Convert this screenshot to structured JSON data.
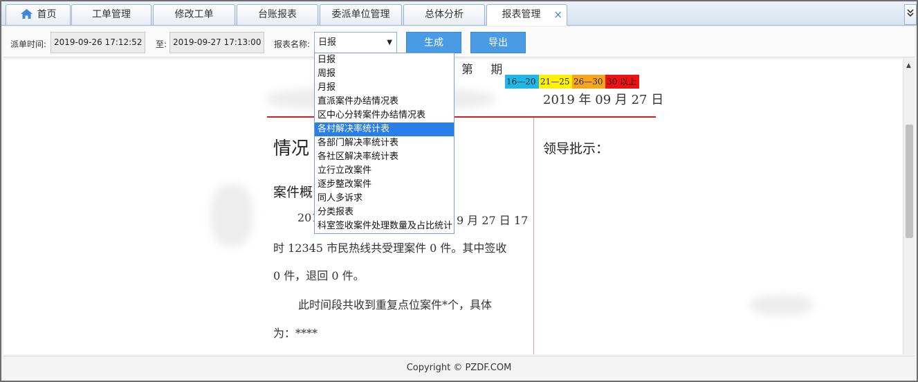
{
  "tabs": [
    {
      "label": "首页",
      "icon": "home-icon"
    },
    {
      "label": "工单管理"
    },
    {
      "label": "修改工单"
    },
    {
      "label": "台账报表"
    },
    {
      "label": "委派单位管理"
    },
    {
      "label": "总体分析"
    },
    {
      "label": "报表管理",
      "active": true,
      "close": "×"
    }
  ],
  "tab_scroll_glyph": "¥",
  "toolbar": {
    "dispatch_time_label": "派单时间:",
    "start_time": "2019-09-26 17:12:52",
    "to_label": "至:",
    "end_time": "2019-09-27 17:13:00",
    "report_name_label": "报表名称:",
    "report_selected": "日报",
    "generate_label": "生成",
    "export_label": "导出"
  },
  "dropdown": {
    "options": [
      "日报",
      "周报",
      "月报",
      "直派案件办结情况表",
      "区中心分转案件办结情况表",
      "各村解决率统计表",
      "各部门解决率统计表",
      "各社区解决率统计表",
      "立行立改案件",
      "逐步整改案件",
      "同人多诉求",
      "分类报表",
      "科室签收案件处理数量及占比统计"
    ],
    "highlighted_index": 5
  },
  "document": {
    "issue": "第 期",
    "legend": [
      {
        "label": "16—20",
        "color": "#1fb6e8"
      },
      {
        "label": "21—25",
        "color": "#fff200"
      },
      {
        "label": "26—30",
        "color": "#f7a51b"
      },
      {
        "label": "30 以上",
        "color": "#ee1111"
      }
    ],
    "date": "2019 年 09 月 27 日",
    "section_title": "情况",
    "subsection_title": "案件概",
    "leader_label": "领导批示：",
    "para1_start": "201",
    "para1_end": "9 月 27 日 17",
    "para1_line2": "时 12345 市民热线共受理案件 0 件。其中签收",
    "para1_line3": "0 件，退回 0 件。",
    "para2_line1": "此时间段共收到重复点位案件*个，具体",
    "para2_line2": "为：****"
  },
  "footer": {
    "copyright": "Copyright © PZDF.COM"
  }
}
